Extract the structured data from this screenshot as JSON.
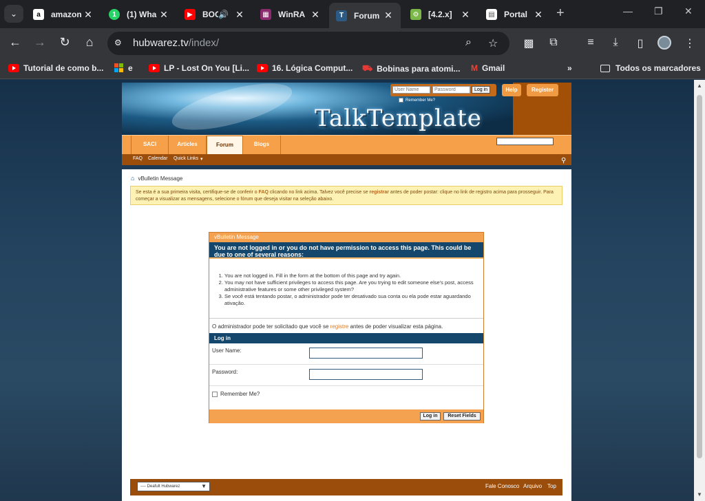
{
  "browser": {
    "tabs": [
      {
        "title": "amazon",
        "icon": "amazon-icon",
        "color": "#ffffff"
      },
      {
        "title": "(1) Wha",
        "icon": "whatsapp-icon",
        "color": "#25d366"
      },
      {
        "title": "BOO",
        "icon": "youtube-icon",
        "color": "#ff0000"
      },
      {
        "title": "WinRA",
        "icon": "winrar-icon",
        "color": "#8b2a6e"
      },
      {
        "title": "Forum",
        "icon": "forum-icon",
        "color": "#2b5a85",
        "active": true
      },
      {
        "title": "[4.2.x]",
        "icon": "android-icon",
        "color": "#7ab648"
      },
      {
        "title": "Portal",
        "icon": "document-icon",
        "color": "#ffffff"
      }
    ],
    "url_host": "hubwarez.tv",
    "url_path": "/index/",
    "bookmarks": [
      {
        "label": "Tutorial de como b...",
        "icon": "youtube-icon"
      },
      {
        "label": "e",
        "icon": "microsoft-icon"
      },
      {
        "label": "LP - Lost On You [Li...",
        "icon": "youtube-icon"
      },
      {
        "label": "16. Lógica Comput...",
        "icon": "youtube-icon"
      },
      {
        "label": "Bobinas para atomi...",
        "icon": "store-icon"
      },
      {
        "label": "Gmail",
        "icon": "gmail-icon"
      }
    ],
    "all_bookmarks_label": "Todos os marcadores"
  },
  "site": {
    "logo": "TalkTemplate",
    "username_placeholder": "User Name",
    "password_placeholder": "Password",
    "login_mini_label": "Log in",
    "remember_mini_label": "Remember Me?",
    "help_label": "Help",
    "register_label": "Register",
    "nav_tabs": [
      "SACI",
      "Articles",
      "Forum",
      "Blogs"
    ],
    "subnav": [
      "FAQ",
      "Calendar",
      "Quick Links"
    ],
    "breadcrumb": "vBulletin Message",
    "notice_part1": "Se esta é a sua primeira visita, certifique-se de conferir o ",
    "notice_faq": "FAQ",
    "notice_part2": " clicando no link acima. Talvez você precise se ",
    "notice_register": "registrar",
    "notice_part3": " antes de poder postar: clique no link de registro acima para prosseguir. Para começar a visualizar as mensagens, selecione o fórum que deseja visitar na seleção abaixo."
  },
  "message": {
    "header": "vBulletin Message",
    "title": "You are not logged in or you do not have permission to access this page. This could be due to one of several reasons:",
    "reasons": [
      "You are not logged in. Fill in the form at the bottom of this page and try again.",
      "You may not have sufficient privileges to access this page. Are you trying to edit someone else's post, access administrative features or some other privileged system?",
      "Se você está tentando postar, o administrador pode ter desativado sua conta ou ela pode estar aguardando ativação."
    ],
    "note_before": "O administrador pode ter solicitado que você se ",
    "note_link": "registre",
    "note_after": " antes de poder visualizar esta página.",
    "login_head": "Log in",
    "username_label": "User Name:",
    "password_label": "Password:",
    "remember_label": "Remember Me?",
    "login_button": "Log in",
    "reset_button": "Reset Fields"
  },
  "footer": {
    "style_select": "---- Deafult Hubwarez",
    "links": [
      "Fale Conosco",
      "Arquivo",
      "Top"
    ]
  },
  "colors": {
    "accent_orange": "#f4a150",
    "header_brown": "#9b4d0c",
    "title_navy": "#14476b"
  }
}
